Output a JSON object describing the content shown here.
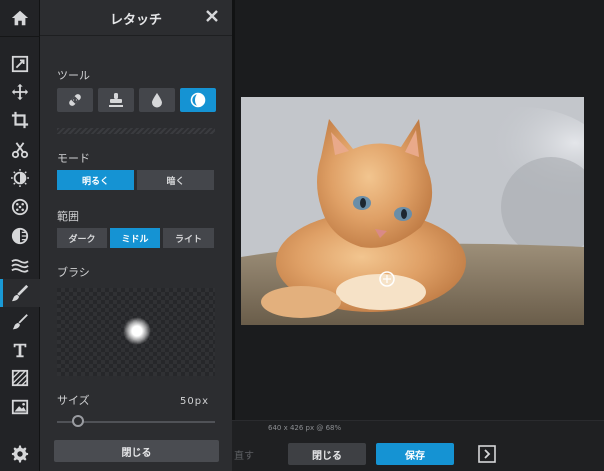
{
  "panel": {
    "title": "レタッチ",
    "tools_label": "ツール",
    "mode_label": "モード",
    "mode_options": [
      "明るく",
      "暗く"
    ],
    "range_label": "範囲",
    "range_options": [
      "ダーク",
      "ミドル",
      "ライト"
    ],
    "brush_label": "ブラシ",
    "size_label": "サイズ",
    "size_value": "50px",
    "size_fraction": 0.13,
    "close_button": "閉じる"
  },
  "tools": [
    {
      "icon": "bandage-icon",
      "active": false
    },
    {
      "icon": "stamp-icon",
      "active": false
    },
    {
      "icon": "drop-icon",
      "active": false
    },
    {
      "icon": "dodge-burn-icon",
      "active": true
    }
  ],
  "mode_active": 0,
  "range_active": 1,
  "rail_icons": [
    "home-icon",
    "edit-icon",
    "move-icon",
    "crop-icon",
    "cut-icon",
    "adjust-icon",
    "effects-icon",
    "filters-icon",
    "wave-icon",
    "brush-icon",
    "paint-brush-icon",
    "text-icon",
    "texture-icon",
    "image-icon",
    "settings-icon"
  ],
  "rail_active": 9,
  "canvas": {
    "status": "640 x 426 px @ 68%"
  },
  "bottom": {
    "undo_label": "直す",
    "close_label": "閉じる",
    "save_label": "保存"
  },
  "colors": {
    "accent": "#1593d3",
    "panel_bg": "#2c2d30",
    "rail_bg": "#222326"
  }
}
